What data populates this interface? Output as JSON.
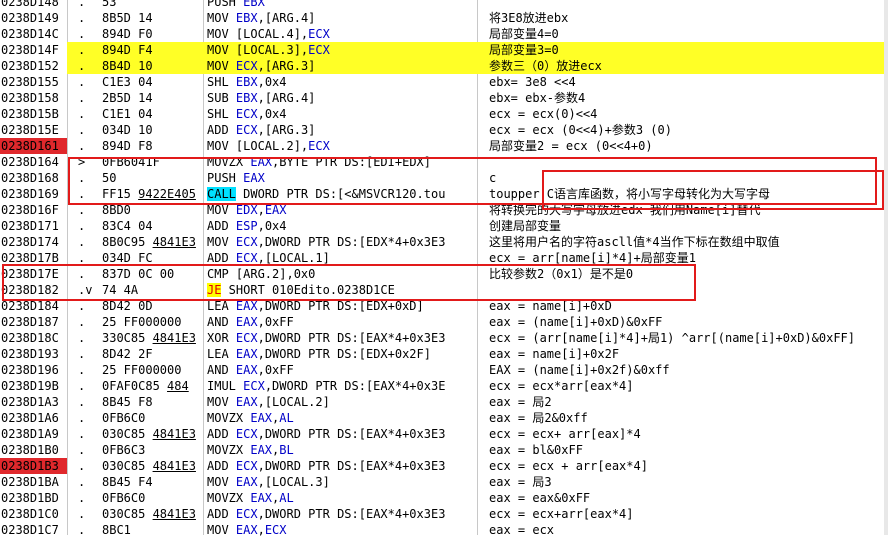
{
  "rows": [
    {
      "addr": "0238D148",
      "mark": ".",
      "hex": "53",
      "asm": [
        [
          "",
          "PUSH "
        ],
        [
          "reg",
          "EBX"
        ]
      ],
      "cmt": ""
    },
    {
      "addr": "0238D149",
      "mark": ".",
      "hex": "8B5D 14",
      "asm": [
        [
          "",
          "MOV "
        ],
        [
          "reg",
          "EBX"
        ],
        [
          "",
          ",[ARG.4]"
        ]
      ],
      "cmt": "将3E8放进ebx"
    },
    {
      "addr": "0238D14C",
      "mark": ".",
      "hex": "894D F0",
      "asm": [
        [
          "",
          "MOV [LOCAL.4],"
        ],
        [
          "reg",
          "ECX"
        ]
      ],
      "cmt": "局部变量4=0"
    },
    {
      "addr": "0238D14F",
      "mark": ".",
      "hex": "894D F4",
      "asm": [
        [
          "",
          "MOV [LOCAL.3],"
        ],
        [
          "reg",
          "ECX"
        ]
      ],
      "cmt": "局部变量3=0",
      "hl": true
    },
    {
      "addr": "0238D152",
      "mark": ".",
      "hex": "8B4D 10",
      "asm": [
        [
          "",
          "MOV "
        ],
        [
          "reg",
          "ECX"
        ],
        [
          "",
          ",[ARG.3]"
        ]
      ],
      "cmt": "参数三（0）放进ecx",
      "hl": true
    },
    {
      "addr": "0238D155",
      "mark": ".",
      "hex": "C1E3 04",
      "asm": [
        [
          "",
          "SHL "
        ],
        [
          "reg",
          "EBX"
        ],
        [
          "",
          ",0x4"
        ]
      ],
      "cmt": "ebx= 3e8 <<4"
    },
    {
      "addr": "0238D158",
      "mark": ".",
      "hex": "2B5D 14",
      "asm": [
        [
          "",
          "SUB "
        ],
        [
          "reg",
          "EBX"
        ],
        [
          "",
          ",[ARG.4]"
        ]
      ],
      "cmt": "ebx= ebx-参数4"
    },
    {
      "addr": "0238D15B",
      "mark": ".",
      "hex": "C1E1 04",
      "asm": [
        [
          "",
          "SHL "
        ],
        [
          "reg",
          "ECX"
        ],
        [
          "",
          ",0x4"
        ]
      ],
      "cmt": "ecx = ecx(0)<<4"
    },
    {
      "addr": "0238D15E",
      "mark": ".",
      "hex": "034D 10",
      "asm": [
        [
          "",
          "ADD "
        ],
        [
          "reg",
          "ECX"
        ],
        [
          "",
          ",[ARG.3]"
        ]
      ],
      "cmt": "ecx = ecx (0<<4)+参数3 (0)"
    },
    {
      "addr": "0238D161",
      "mark": ".",
      "hex": "894D F8",
      "asm": [
        [
          "",
          "MOV [LOCAL.2],"
        ],
        [
          "reg",
          "ECX"
        ]
      ],
      "cmt": "局部变量2 = ecx (0<<4+0)",
      "bp": true
    },
    {
      "addr": "0238D164",
      "mark": ">",
      "hex": "0FB6041F",
      "asm": [
        [
          "",
          "MOVZX "
        ],
        [
          "reg",
          "EAX"
        ],
        [
          "",
          ",BYTE PTR DS:[EDI+EDX]"
        ]
      ],
      "cmt": ""
    },
    {
      "addr": "0238D168",
      "mark": ".",
      "hex": "50",
      "asm": [
        [
          "",
          "PUSH "
        ],
        [
          "reg",
          "EAX"
        ]
      ],
      "cmt": "c"
    },
    {
      "addr": "0238D169",
      "mark": ".",
      "hex": "FF15 9422E405",
      "hexu": true,
      "asm": [
        [
          "kw",
          "CALL"
        ],
        [
          "",
          " DWORD PTR DS:[<&MSVCR120.tou"
        ]
      ],
      "cmt": "toupper C语言库函数，将小写字母转化为大写字母"
    },
    {
      "addr": "0238D16F",
      "mark": ".",
      "hex": "8BD0",
      "asm": [
        [
          "",
          "MOV "
        ],
        [
          "reg",
          "EDX"
        ],
        [
          "",
          ","
        ],
        [
          "reg",
          "EAX"
        ]
      ],
      "cmt": "将转换完的大写字母放进edx  我们用Name[i]替代"
    },
    {
      "addr": "0238D171",
      "mark": ".",
      "hex": "83C4 04",
      "asm": [
        [
          "",
          "ADD "
        ],
        [
          "reg",
          "ESP"
        ],
        [
          "",
          ",0x4"
        ]
      ],
      "cmt": "创建局部变量"
    },
    {
      "addr": "0238D174",
      "mark": ".",
      "hex": "8B0C95 4841E3",
      "hexu": true,
      "asm": [
        [
          "",
          "MOV "
        ],
        [
          "reg",
          "ECX"
        ],
        [
          "",
          ",DWORD PTR DS:[EDX*4+0x3E3"
        ]
      ],
      "cmt": "这里将用户名的字符ascll值*4当作下标在数组中取值"
    },
    {
      "addr": "0238D17B",
      "mark": ".",
      "hex": "034D FC",
      "asm": [
        [
          "",
          "ADD "
        ],
        [
          "reg",
          "ECX"
        ],
        [
          "",
          ",[LOCAL.1]"
        ]
      ],
      "cmt": "ecx = arr[name[i]*4]+局部变量1"
    },
    {
      "addr": "0238D17E",
      "mark": ".",
      "hex": "837D 0C 00",
      "asm": [
        [
          "",
          "CMP [ARG.2],0x0"
        ]
      ],
      "cmt": "比较参数2（0x1）是不是0"
    },
    {
      "addr": "0238D182",
      "mark": ".v",
      "hex": "74 4A",
      "asm": [
        [
          "jkw",
          "JE"
        ],
        [
          "",
          " SHORT 010Edito.0238D1CE"
        ]
      ],
      "cmt": ""
    },
    {
      "addr": "0238D184",
      "mark": ".",
      "hex": "8D42 0D",
      "asm": [
        [
          "",
          "LEA "
        ],
        [
          "reg",
          "EAX"
        ],
        [
          "",
          ",DWORD PTR DS:[EDX+0xD]"
        ]
      ],
      "cmt": "eax = name[i]+0xD"
    },
    {
      "addr": "0238D187",
      "mark": ".",
      "hex": "25 FF000000",
      "asm": [
        [
          "",
          "AND "
        ],
        [
          "reg",
          "EAX"
        ],
        [
          "",
          ",0xFF"
        ]
      ],
      "cmt": "eax = (name[i]+0xD)&0xFF"
    },
    {
      "addr": "0238D18C",
      "mark": ".",
      "hex": "330C85 4841E3",
      "hexu": true,
      "asm": [
        [
          "",
          "XOR "
        ],
        [
          "reg",
          "ECX"
        ],
        [
          "",
          ",DWORD PTR DS:[EAX*4+0x3E3"
        ]
      ],
      "cmt": "ecx =  (arr[name[i]*4]+局1) ^arr[(name[i]+0xD)&0xFF]"
    },
    {
      "addr": "0238D193",
      "mark": ".",
      "hex": "8D42 2F",
      "asm": [
        [
          "",
          "LEA "
        ],
        [
          "reg",
          "EAX"
        ],
        [
          "",
          ",DWORD PTR DS:[EDX+0x2F]"
        ]
      ],
      "cmt": "eax = name[i]+0x2F"
    },
    {
      "addr": "0238D196",
      "mark": ".",
      "hex": "25 FF000000",
      "asm": [
        [
          "",
          "AND "
        ],
        [
          "reg",
          "EAX"
        ],
        [
          "",
          ",0xFF"
        ]
      ],
      "cmt": "EAX = (name[i]+0x2f)&0xff"
    },
    {
      "addr": "0238D19B",
      "mark": ".",
      "hex": "0FAF0C85 484",
      "hexu": true,
      "asm": [
        [
          "",
          "IMUL "
        ],
        [
          "reg",
          "ECX"
        ],
        [
          "",
          ",DWORD PTR DS:[EAX*4+0x3E"
        ]
      ],
      "cmt": "ecx = ecx*arr[eax*4]"
    },
    {
      "addr": "0238D1A3",
      "mark": ".",
      "hex": "8B45 F8",
      "asm": [
        [
          "",
          "MOV "
        ],
        [
          "reg",
          "EAX"
        ],
        [
          "",
          ",[LOCAL.2]"
        ]
      ],
      "cmt": "eax = 局2"
    },
    {
      "addr": "0238D1A6",
      "mark": ".",
      "hex": "0FB6C0",
      "asm": [
        [
          "",
          "MOVZX "
        ],
        [
          "reg",
          "EAX"
        ],
        [
          "",
          ","
        ],
        [
          "reg",
          "AL"
        ]
      ],
      "cmt": "eax = 局2&0xff"
    },
    {
      "addr": "0238D1A9",
      "mark": ".",
      "hex": "030C85 4841E3",
      "hexu": true,
      "asm": [
        [
          "",
          "ADD "
        ],
        [
          "reg",
          "ECX"
        ],
        [
          "",
          ",DWORD PTR DS:[EAX*4+0x3E3"
        ]
      ],
      "cmt": "ecx = ecx+ arr[eax]*4"
    },
    {
      "addr": "0238D1B0",
      "mark": ".",
      "hex": "0FB6C3",
      "asm": [
        [
          "",
          "MOVZX "
        ],
        [
          "reg",
          "EAX"
        ],
        [
          "",
          ","
        ],
        [
          "reg",
          "BL"
        ]
      ],
      "cmt": "eax = bl&0xFF"
    },
    {
      "addr": "0238D1B3",
      "mark": ".",
      "hex": "030C85 4841E3",
      "hexu": true,
      "asm": [
        [
          "",
          "ADD "
        ],
        [
          "reg",
          "ECX"
        ],
        [
          "",
          ",DWORD PTR DS:[EAX*4+0x3E3"
        ]
      ],
      "cmt": "ecx = ecx + arr[eax*4]",
      "bp": true
    },
    {
      "addr": "0238D1BA",
      "mark": ".",
      "hex": "8B45 F4",
      "asm": [
        [
          "",
          "MOV "
        ],
        [
          "reg",
          "EAX"
        ],
        [
          "",
          ",[LOCAL.3]"
        ]
      ],
      "cmt": "eax = 局3"
    },
    {
      "addr": "0238D1BD",
      "mark": ".",
      "hex": "0FB6C0",
      "asm": [
        [
          "",
          "MOVZX "
        ],
        [
          "reg",
          "EAX"
        ],
        [
          "",
          ","
        ],
        [
          "reg",
          "AL"
        ]
      ],
      "cmt": "eax = eax&0xFF"
    },
    {
      "addr": "0238D1C0",
      "mark": ".",
      "hex": "030C85 4841E3",
      "hexu": true,
      "asm": [
        [
          "",
          "ADD "
        ],
        [
          "reg",
          "ECX"
        ],
        [
          "",
          ",DWORD PTR DS:[EAX*4+0x3E3"
        ]
      ],
      "cmt": "ecx = ecx+arr[eax*4]"
    },
    {
      "addr": "0238D1C7",
      "mark": ".",
      "hex": "8BC1",
      "asm": [
        [
          "",
          "MOV "
        ],
        [
          "reg",
          "EAX"
        ],
        [
          "",
          ","
        ],
        [
          "reg",
          "ECX"
        ]
      ],
      "cmt": "eax = ecx"
    }
  ],
  "colors": {
    "breakpoint": "#e0282c",
    "highlight": "#ffff26",
    "register": "#0000c8",
    "annotation_box": "#e21a1a"
  }
}
